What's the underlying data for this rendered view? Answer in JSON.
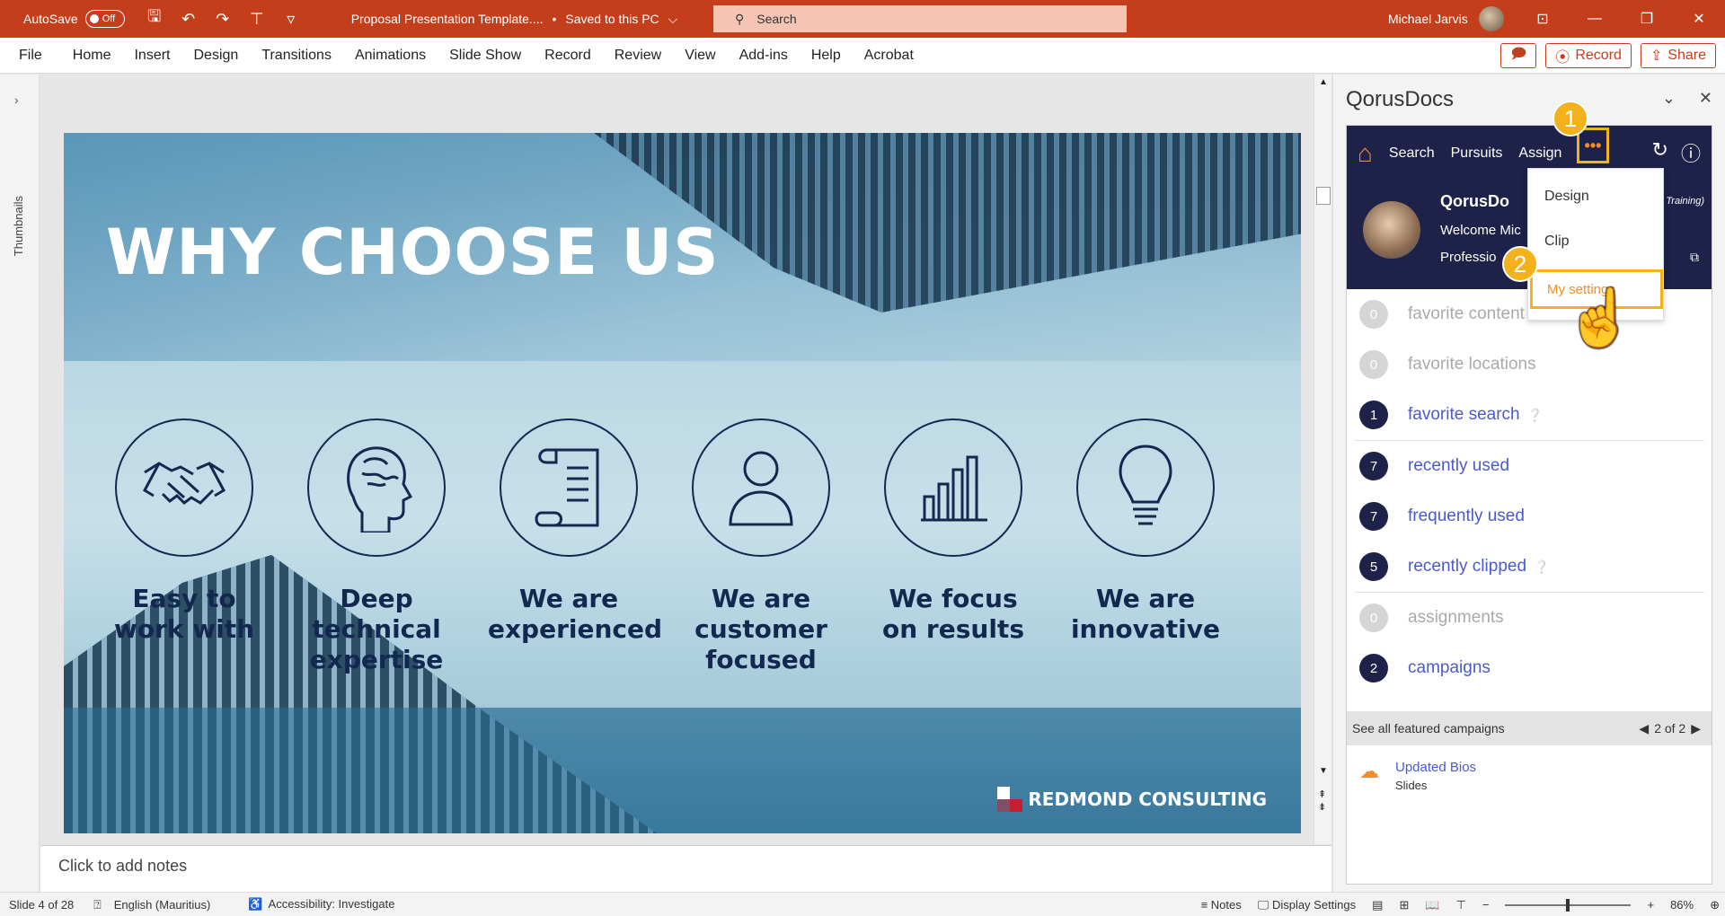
{
  "titlebar": {
    "autosave_label": "AutoSave",
    "autosave_state": "Off",
    "doc_title": "Proposal Presentation Template....",
    "save_state": "Saved to this PC",
    "save_chevron": "⌵",
    "search_placeholder": "Search",
    "user_name": "Michael Jarvis"
  },
  "ribbon": {
    "tabs": [
      "File",
      "Home",
      "Insert",
      "Design",
      "Transitions",
      "Animations",
      "Slide Show",
      "Record",
      "Review",
      "View",
      "Add-ins",
      "Help",
      "Acrobat"
    ],
    "record_label": "Record",
    "share_label": "Share"
  },
  "thumbnails": {
    "label": "Thumbnails"
  },
  "slide": {
    "title": "WHY CHOOSE US",
    "features": [
      {
        "text": "Easy to work with",
        "icon": "handshake-icon"
      },
      {
        "text": "Deep technical expertise",
        "icon": "brain-icon"
      },
      {
        "text": "We are experienced",
        "icon": "scroll-icon"
      },
      {
        "text": "We are customer focused",
        "icon": "person-icon"
      },
      {
        "text": "We focus on results",
        "icon": "bar-chart-icon"
      },
      {
        "text": "We are innovative",
        "icon": "lightbulb-icon"
      }
    ],
    "brand": "REDMOND CONSULTING"
  },
  "notes": {
    "placeholder": "Click to add notes"
  },
  "status": {
    "slide": "Slide 4 of 28",
    "language": "English (Mauritius)",
    "accessibility": "Accessibility: Investigate",
    "notes": "Notes",
    "display": "Display Settings",
    "zoom": "86%"
  },
  "pane": {
    "title": "QorusDocs",
    "nav": {
      "search": "Search",
      "pursuits": "Pursuits",
      "assign": "Assign",
      "more": "•••"
    },
    "logo": "QorusDo",
    "welcome": "Welcome Mic",
    "profession": "Professio",
    "training": "Training)",
    "menu": {
      "design": "Design",
      "clip": "Clip",
      "settings": "My settings"
    },
    "list": [
      {
        "count": "0",
        "label": "favorite content",
        "disabled": true
      },
      {
        "count": "0",
        "label": "favorite locations",
        "disabled": true
      },
      {
        "count": "1",
        "label": "favorite search",
        "disabled": false,
        "help": true
      },
      {
        "count": "7",
        "label": "recently used",
        "disabled": false
      },
      {
        "count": "7",
        "label": "frequently used",
        "disabled": false
      },
      {
        "count": "5",
        "label": "recently clipped",
        "disabled": false,
        "help": true
      },
      {
        "count": "0",
        "label": "assignments",
        "disabled": true
      },
      {
        "count": "2",
        "label": "campaigns",
        "disabled": false
      }
    ],
    "featured": {
      "label": "See all featured campaigns",
      "page": "2 of 2"
    },
    "campaign": {
      "title": "Updated Bios",
      "subtitle": "Slides",
      "icon": "campaign-icon"
    }
  },
  "callouts": {
    "one": "1",
    "two": "2"
  },
  "colors": {
    "accent": "#c43e1c",
    "navy": "#1e2148",
    "highlight": "#f3b21c",
    "link": "#4a5ad0"
  }
}
